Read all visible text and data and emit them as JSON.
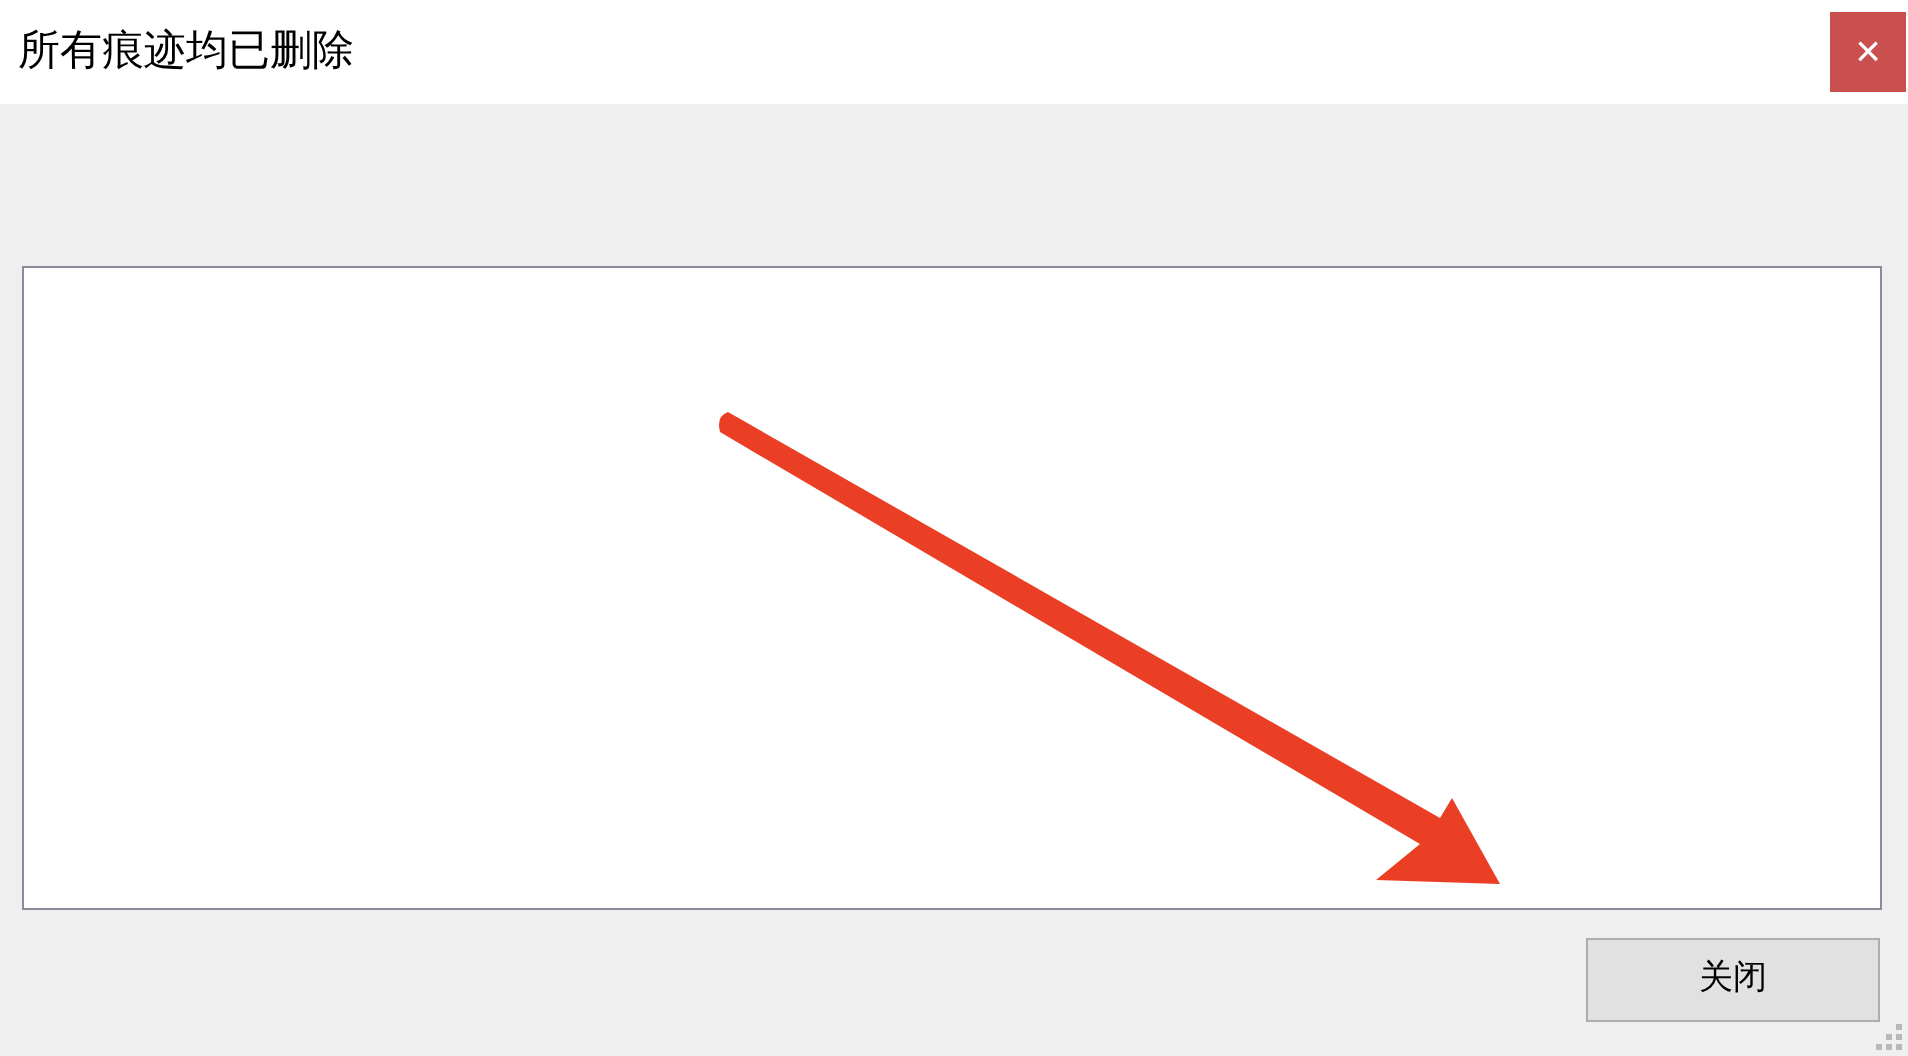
{
  "window": {
    "title": "所有痕迹均已删除",
    "close_glyph": "×"
  },
  "log_area": {
    "kind": "textarea"
  },
  "buttons": [
    {
      "label": "关闭"
    }
  ]
}
